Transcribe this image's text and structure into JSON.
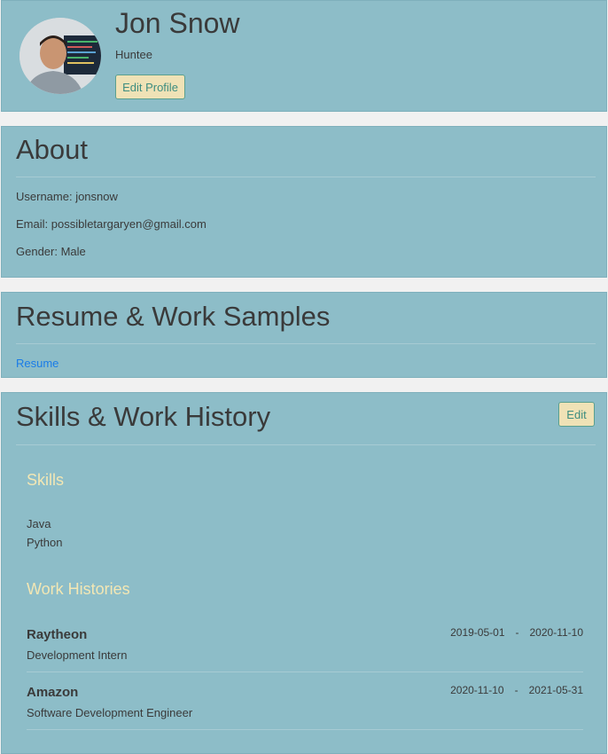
{
  "profile": {
    "name": "Jon Snow",
    "role": "Huntee",
    "edit_label": "Edit Profile"
  },
  "about": {
    "title": "About",
    "username": "Username: jonsnow",
    "email": "Email: possibletargaryen@gmail.com",
    "gender": "Gender: Male"
  },
  "resume": {
    "title": "Resume & Work Samples",
    "link": "Resume"
  },
  "skills_section": {
    "title": "Skills & Work History",
    "edit_label": "Edit",
    "skills_heading": "Skills",
    "skills": [
      "Java",
      "Python"
    ],
    "work_heading": "Work Histories",
    "work": [
      {
        "company": "Raytheon",
        "position": "Development Intern",
        "start": "2019-05-01",
        "sep": "-",
        "end": "2020-11-10"
      },
      {
        "company": "Amazon",
        "position": "Software Development Engineer",
        "start": "2020-11-10",
        "sep": "-",
        "end": "2021-05-31"
      }
    ]
  }
}
